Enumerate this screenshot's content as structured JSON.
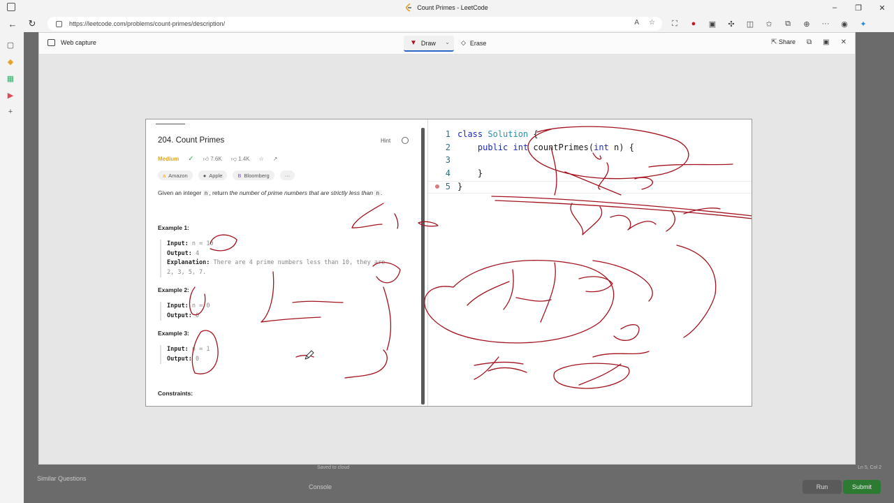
{
  "browser": {
    "tab_title": "Count Primes - LeetCode",
    "url": "https://leetcode.com/problems/count-primes/description/"
  },
  "capture": {
    "title": "Web capture",
    "draw_label": "Draw",
    "erase_label": "Erase",
    "share_label": "Share"
  },
  "problem": {
    "title": "204. Count Primes",
    "hint_label": "Hint",
    "difficulty": "Medium",
    "likes": "7.6K",
    "dislikes": "1.4K",
    "tags": [
      "Amazon",
      "Apple",
      "Bloomberg",
      "···"
    ],
    "desc_prefix": "Given an integer ",
    "desc_var": "n",
    "desc_mid": ", return ",
    "desc_em": "the number of prime numbers that are strictly less than",
    "desc_suffix": ".",
    "examples": [
      {
        "heading": "Example 1:",
        "input_label": "Input:",
        "input_value": "n = 10",
        "output_label": "Output:",
        "output_value": "4",
        "explanation_label": "Explanation:",
        "explanation_value": "There are 4 prime numbers less than 10, they are",
        "explanation_value_2": "2, 3, 5, 7."
      },
      {
        "heading": "Example 2:",
        "input_label": "Input:",
        "input_value": "n = 0",
        "output_label": "Output:",
        "output_value": "0"
      },
      {
        "heading": "Example 3:",
        "input_label": "Input:",
        "input_value": "n = 1",
        "output_label": "Output:",
        "output_value": "0"
      }
    ],
    "constraints_heading": "Constraints:"
  },
  "editor": {
    "lines": [
      {
        "num": "1",
        "parts": [
          [
            "kw",
            "class"
          ],
          [
            "",
            " "
          ],
          [
            "cls",
            "Solution"
          ],
          [
            "",
            " {"
          ]
        ]
      },
      {
        "num": "2",
        "parts": [
          [
            "",
            "    "
          ],
          [
            "kw",
            "public"
          ],
          [
            "",
            " "
          ],
          [
            "kw",
            "int"
          ],
          [
            "",
            " countPrimes("
          ],
          [
            "kw",
            "int"
          ],
          [
            "",
            " n) {"
          ]
        ]
      },
      {
        "num": "3",
        "parts": [
          [
            "",
            ""
          ]
        ]
      },
      {
        "num": "4",
        "parts": [
          [
            "",
            "    }"
          ]
        ]
      },
      {
        "num": "5",
        "parts": [
          [
            "",
            "}"
          ]
        ]
      }
    ]
  },
  "background_page": {
    "similar_questions": "Similar Questions",
    "console": "Console",
    "saved": "Saved to cloud",
    "cursor_pos": "Ln 5, Col 2",
    "run": "Run",
    "submit": "Submit"
  },
  "colors": {
    "ink": "#a3121d",
    "submit": "#2d7a33",
    "draw_active": "#2a67c9"
  }
}
